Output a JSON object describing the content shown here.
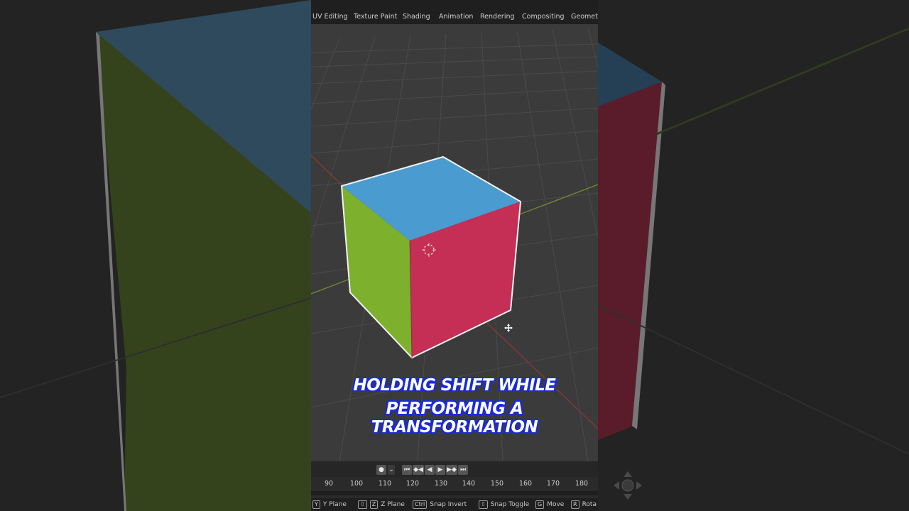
{
  "header_tabs": [
    "UV Editing",
    "Texture Paint",
    "Shading",
    "Animation",
    "Rendering",
    "Compositing",
    "Geometr"
  ],
  "caption": {
    "line1": "HOLDING SHIFT WHILE",
    "line2": "PERFORMING A TRANSFORMATION"
  },
  "timeline": {
    "frames": [
      "90",
      "100",
      "110",
      "120",
      "130",
      "140",
      "150",
      "160",
      "170",
      "180"
    ],
    "record_label": "●",
    "jump_start": "⏮",
    "prev_key": "◆◀",
    "play_reverse": "◀",
    "play": "▶",
    "next_key": "▶◆",
    "jump_end": "⏭"
  },
  "status_bar": {
    "items": [
      {
        "key": "Y",
        "label": "Y Plane"
      },
      {
        "key": "⇧",
        "key2": "Z",
        "label": "Z Plane"
      },
      {
        "key": "Ctrl",
        "label": "Snap Invert"
      },
      {
        "key": "⇧",
        "label": "Snap Toggle"
      },
      {
        "key": "G",
        "label": "Move"
      },
      {
        "key": "R",
        "label": "Rota"
      }
    ]
  },
  "colors": {
    "cube_top": "#4a9bd0",
    "cube_front": "#c52e55",
    "cube_left": "#7db02c",
    "caption_outline": "#1a2ad8",
    "viewport_bg": "#3b3b3b"
  },
  "icons": [
    "3d-cursor-icon",
    "move-cursor-icon",
    "navigation-gizmo-icon"
  ]
}
